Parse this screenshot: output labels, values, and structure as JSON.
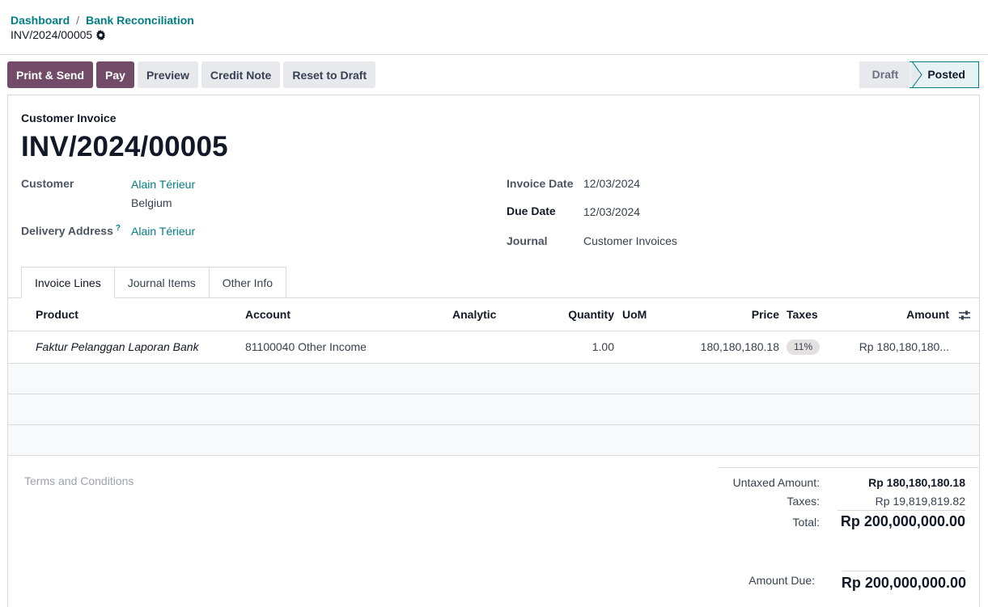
{
  "breadcrumb": {
    "root": "Dashboard",
    "parent": "Bank Reconciliation",
    "separator": "/"
  },
  "record": {
    "name": "INV/2024/00005"
  },
  "toolbar": {
    "print_send": "Print & Send",
    "pay": "Pay",
    "preview": "Preview",
    "credit_note": "Credit Note",
    "reset_draft": "Reset to Draft"
  },
  "status": {
    "draft": "Draft",
    "posted": "Posted",
    "current": "Posted"
  },
  "form": {
    "doc_type": "Customer Invoice",
    "doc_name": "INV/2024/00005",
    "customer_label": "Customer",
    "customer_name": "Alain Térieur",
    "customer_country": "Belgium",
    "delivery_label": "Delivery Address",
    "delivery_help": "?",
    "delivery_name": "Alain Térieur",
    "invoice_date_label": "Invoice Date",
    "invoice_date": "12/03/2024",
    "due_date_label": "Due Date",
    "due_date": "12/03/2024",
    "journal_label": "Journal",
    "journal": "Customer Invoices"
  },
  "tabs": [
    "Invoice Lines",
    "Journal Items",
    "Other Info"
  ],
  "table": {
    "headers": {
      "product": "Product",
      "account": "Account",
      "analytic": "Analytic",
      "quantity": "Quantity",
      "uom": "UoM",
      "price": "Price",
      "taxes": "Taxes",
      "amount": "Amount"
    },
    "rows": [
      {
        "product": "Faktur Pelanggan Laporan Bank",
        "account": "81100040 Other Income",
        "quantity": "1.00",
        "price": "180,180,180.18",
        "tax": "11%",
        "amount": "Rp 180,180,180..."
      }
    ]
  },
  "terms_placeholder": "Terms and Conditions",
  "totals": {
    "untaxed_label": "Untaxed Amount:",
    "untaxed": "Rp 180,180,180.18",
    "taxes_label": "Taxes:",
    "taxes": "Rp 19,819,819.82",
    "total_label": "Total:",
    "total": "Rp 200,000,000.00",
    "due_label": "Amount Due:",
    "due": "Rp 200,000,000.00"
  },
  "colors": {
    "primary": "#714b67",
    "link": "#017e84",
    "border": "#d8dadd"
  },
  "icons": {
    "record_settings": "gear-icon",
    "column_settings": "sliders-icon"
  }
}
